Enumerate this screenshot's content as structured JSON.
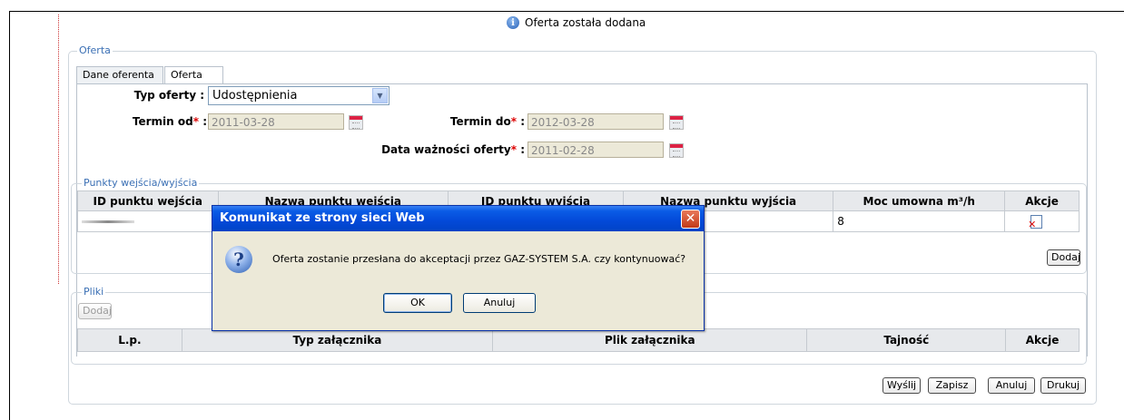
{
  "notice": "Oferta została dodana",
  "oferta_legend": "Oferta",
  "tabs": [
    {
      "label": "Dane oferenta"
    },
    {
      "label": "Oferta"
    }
  ],
  "form": {
    "typ_label": "Typ oferty",
    "typ_value": "Udostępnienia",
    "termin_od_label": "Termin od",
    "termin_od_value": "2011-03-28",
    "termin_do_label": "Termin do",
    "termin_do_value": "2012-03-28",
    "data_waznosci_label": "Data ważności oferty",
    "data_waznosci_value": "2011-02-28"
  },
  "points": {
    "legend": "Punkty wejścia/wyjścia",
    "headers": [
      "ID punktu wejścia",
      "Nazwa punktu wejścia",
      "ID punktu wyjścia",
      "Nazwa punktu wyjścia",
      "Moc umowna m³/h",
      "Akcje"
    ],
    "row": {
      "moc": "8"
    },
    "add_button": "Dodaj"
  },
  "files": {
    "legend": "Pliki",
    "add_button": "Dodaj",
    "headers": [
      "L.p.",
      "Typ załącznika",
      "Plik załącznika",
      "Tajność",
      "Akcje"
    ]
  },
  "buttons": {
    "wyslij": "Wyślij",
    "zapisz": "Zapisz",
    "anuluj": "Anuluj",
    "drukuj": "Drukuj"
  },
  "dialog": {
    "title": "Komunikat ze strony sieci Web",
    "message": "Oferta zostanie przesłana do akceptacji przez GAZ-SYSTEM S.A. czy kontynuować?",
    "ok": "OK",
    "cancel": "Anuluj"
  },
  "colors": {
    "accent": "#3a6fb4",
    "required": "#dd0000",
    "dialog_title": "#0a5ce6"
  }
}
